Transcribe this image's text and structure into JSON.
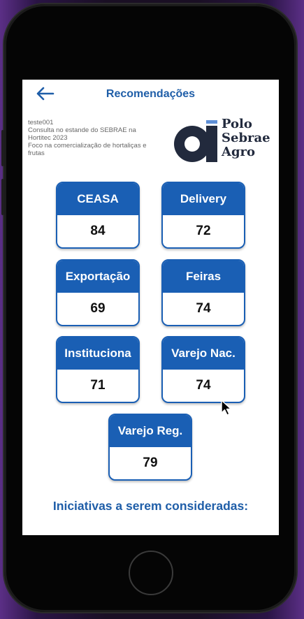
{
  "header": {
    "title": "Recomendações"
  },
  "info": {
    "lines": [
      "teste001",
      "Consulta no estande do SEBRAE na",
      "Hortitec 2023",
      "Foco na comercialização de hortaliças e",
      "frutas"
    ]
  },
  "logo": {
    "line1": "Polo",
    "line2": "Sebrae",
    "line3": "Agro"
  },
  "cards": [
    {
      "label": "CEASA",
      "value": "84"
    },
    {
      "label": "Delivery",
      "value": "72"
    },
    {
      "label": "Exportação",
      "value": "69"
    },
    {
      "label": "Feiras",
      "value": "74"
    },
    {
      "label": "Instituciona",
      "value": "71"
    },
    {
      "label": "Varejo Nac.",
      "value": "74"
    },
    {
      "label": "Varejo Reg.",
      "value": "79"
    }
  ],
  "section": {
    "title": "Iniciativas a serem consideradas:"
  },
  "colors": {
    "primary": "#1a5fb4",
    "title": "#1f5ea8",
    "logo": "#222a3d"
  },
  "icons": {
    "back": "arrow-left-icon",
    "logo": "polo-sebrae-agro-logo"
  }
}
